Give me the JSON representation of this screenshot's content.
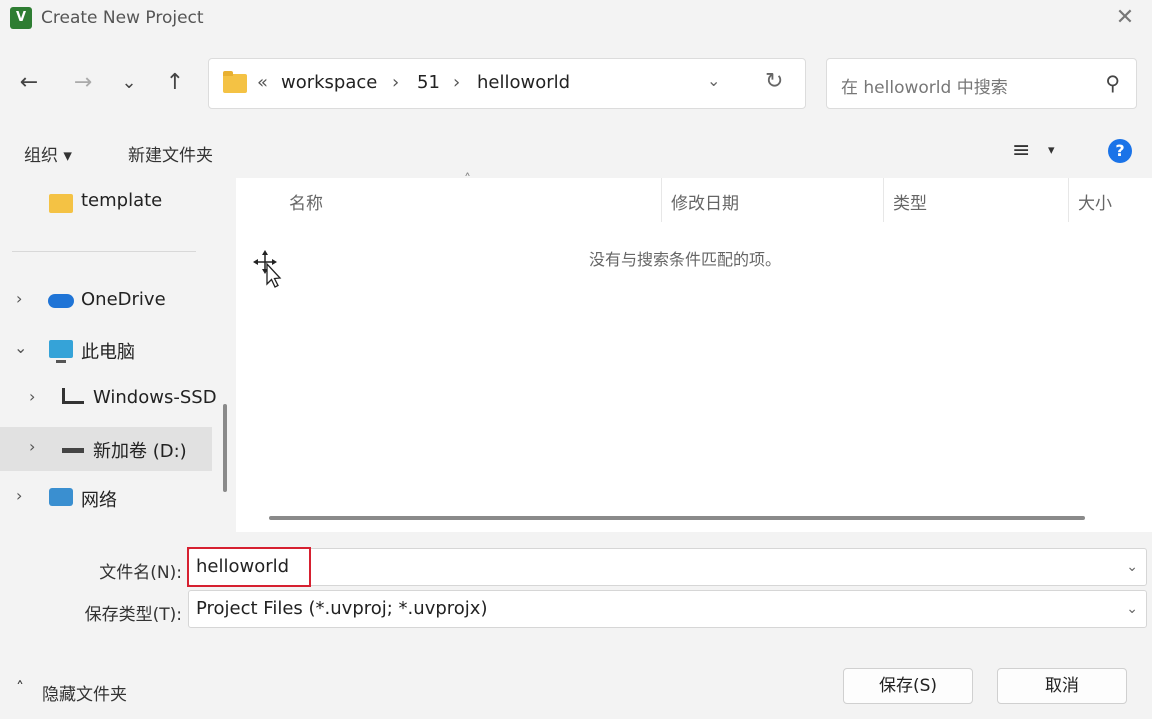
{
  "window": {
    "title": "Create New Project",
    "app_icon": "keil-uvision-icon",
    "close_glyph": "✕"
  },
  "nav_buttons": {
    "back": "←",
    "forward": "→",
    "recent": "⌄",
    "up": "↑"
  },
  "address": {
    "prefix": "«",
    "crumbs": [
      "workspace",
      "51",
      "helloworld"
    ],
    "separator": "›",
    "dropdown_glyph": "⌄",
    "refresh_glyph": "↻"
  },
  "search": {
    "placeholder": "在 helloworld 中搜索",
    "icon_glyph": "⚲"
  },
  "toolbar": {
    "organize": "组织 ▾",
    "new_folder": "新建文件夹",
    "view_glyph": "≡",
    "view_drop": "▾",
    "help_glyph": "?"
  },
  "nav_pane": {
    "items": [
      {
        "label": "template",
        "icon": "folder-icon",
        "chevron": ""
      },
      {
        "label": "OneDrive",
        "icon": "cloud-icon",
        "chevron": "›"
      },
      {
        "label": "此电脑",
        "icon": "computer-icon",
        "chevron": "⌄"
      },
      {
        "label": "Windows-SSD",
        "icon": "windows-drive-icon",
        "chevron": "›"
      },
      {
        "label": "新加卷 (D:)",
        "icon": "drive-icon",
        "chevron": "›"
      },
      {
        "label": "网络",
        "icon": "network-icon",
        "chevron": "›"
      }
    ]
  },
  "file_list": {
    "columns": [
      "名称",
      "修改日期",
      "类型",
      "大小"
    ],
    "sort_glyph": "˄",
    "empty_message": "没有与搜索条件匹配的项。"
  },
  "fields": {
    "filename_label": "文件名(N):",
    "filename_value": "helloworld",
    "filetype_label": "保存类型(T):",
    "filetype_value": "Project Files (*.uvproj; *.uvprojx)",
    "dropdown_glyph": "⌄"
  },
  "footer": {
    "hide_folders": "隐藏文件夹",
    "hide_glyph": "˄",
    "save": "保存(S)",
    "cancel": "取消"
  },
  "colors": {
    "highlight": "#d62030",
    "folder": "#f4c244",
    "accent": "#1a73e8"
  }
}
